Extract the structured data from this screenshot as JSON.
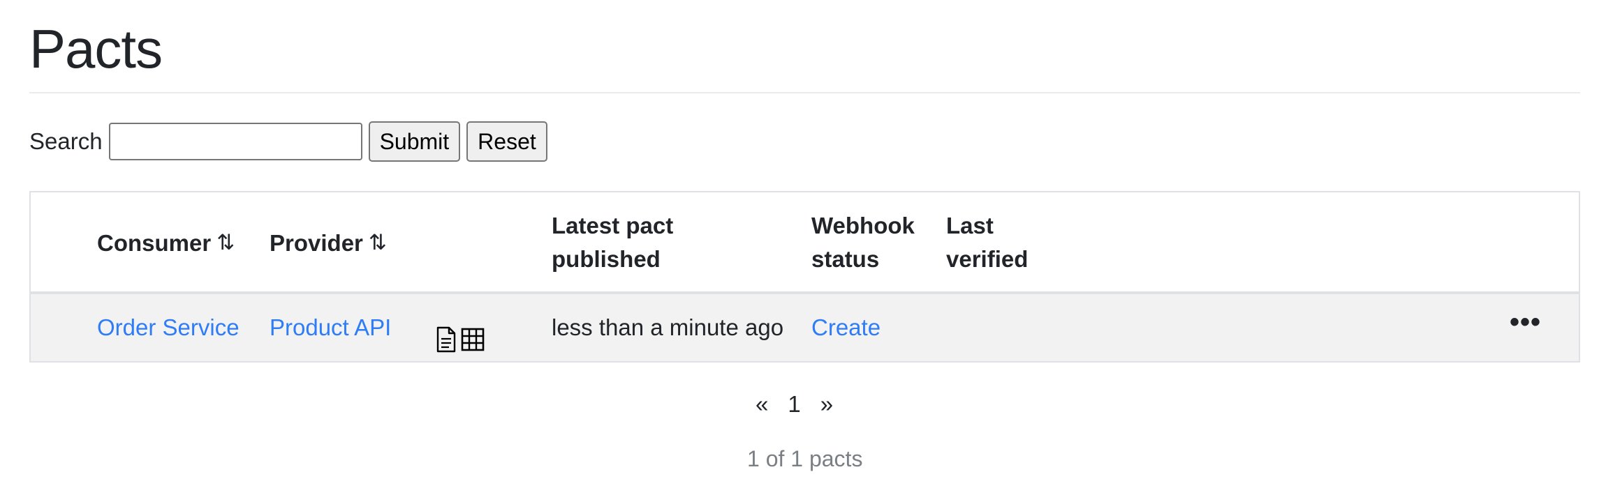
{
  "page": {
    "title": "Pacts"
  },
  "search": {
    "label": "Search",
    "value": "",
    "placeholder": "",
    "submit_label": "Submit",
    "reset_label": "Reset"
  },
  "table": {
    "headers": {
      "consumer": "Consumer",
      "provider": "Provider",
      "latest_pact_published_line1": "Latest pact",
      "latest_pact_published_line2": "published",
      "webhook_status_line1": "Webhook",
      "webhook_status_line2": "status",
      "last_verified_line1": "Last",
      "last_verified_line2": "verified",
      "sort_icon": "sort-icon"
    },
    "rows": [
      {
        "consumer": "Order Service",
        "provider": "Product API",
        "latest_pact_published": "less than a minute ago",
        "webhook_status": "Create",
        "last_verified": "",
        "icons": [
          "document-icon",
          "matrix-icon",
          "more-options-icon"
        ]
      }
    ]
  },
  "pagination": {
    "previous": "«",
    "current_page": "1",
    "next": "»",
    "summary": "1 of 1 pacts"
  },
  "colors": {
    "link": "#2f7df6",
    "row_background": "#f2f2f2",
    "border": "#dee2e6",
    "muted_text": "#7a7f85"
  }
}
